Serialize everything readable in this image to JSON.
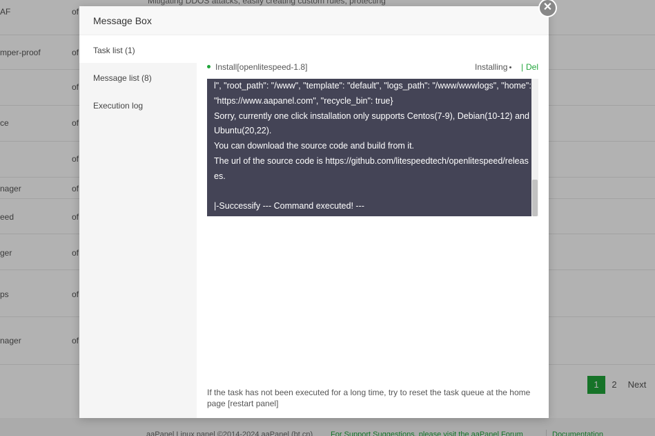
{
  "background": {
    "top_text": "Mitigating DDOS attacks, easily creating custom rules, protecting",
    "rows": [
      {
        "name": "AF",
        "col2": "of"
      },
      {
        "name": "mper-proof",
        "col2": "of"
      },
      {
        "name": "",
        "col2": "of"
      },
      {
        "name": "ce",
        "col2": "of"
      },
      {
        "name": "",
        "col2": "of"
      },
      {
        "name": "nager",
        "col2": "of"
      },
      {
        "name": "eed",
        "col2": "of"
      },
      {
        "name": "ger",
        "col2": "of"
      },
      {
        "name": "ps",
        "col2": "of"
      },
      {
        "name": "nager",
        "col2": "of"
      }
    ],
    "pager": {
      "page1": "1",
      "page2": "2",
      "next": "Next"
    },
    "footer": {
      "copyright": "aaPanel Linux panel ©2014-2024 aaPanel (bt.cn)",
      "support": "For Support Suggestions, please visit the aaPanel Forum",
      "separator": "|",
      "docs": "Documentation"
    }
  },
  "modal": {
    "title": "Message Box",
    "close_glyph": "✕",
    "sidebar": [
      {
        "label": "Task list (1)"
      },
      {
        "label": "Message list (8)"
      },
      {
        "label": "Execution log"
      }
    ],
    "task": {
      "name": "Install[openlitespeed-1.8]",
      "status": "Installing",
      "del_separator": "|",
      "del_label": "Del"
    },
    "console_text": "l\", \"root_path\": \"/www\", \"template\": \"default\", \"logs_path\": \"/www/wwwlogs\", \"home\": \"https://www.aapanel.com\", \"recycle_bin\": true}\nSorry, currently one click installation only supports Centos(7-9), Debian(10-12) and Ubuntu(20,22).\nYou can download the source code and build from it.\nThe url of the source code is https://github.com/litespeedtech/openlitespeed/releases.\n\n|-Successify --- Command executed! ---",
    "hint": "If the task has not been executed for a long time, try to reset the task queue at the home page [restart panel]"
  },
  "colors": {
    "accent": "#20a53a",
    "console_bg": "#444456"
  }
}
